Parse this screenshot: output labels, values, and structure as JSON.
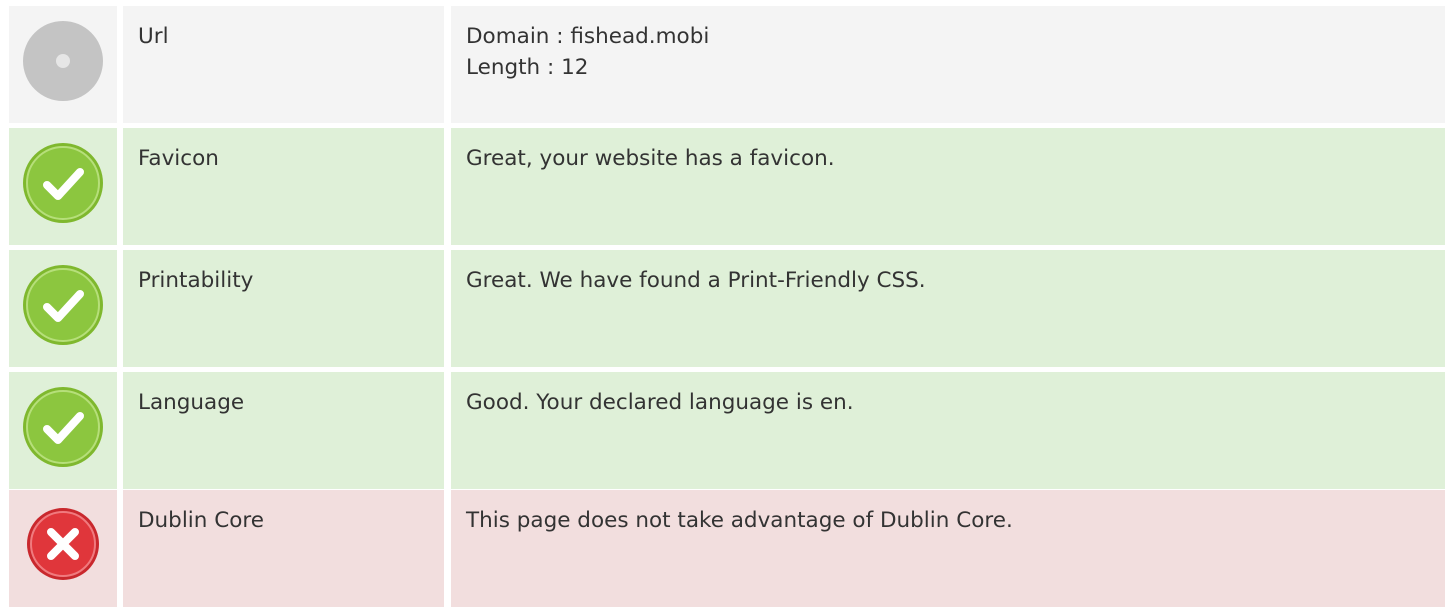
{
  "colors": {
    "neutral_bg": "#f4f4f4",
    "pass_bg": "#dff0d8",
    "fail_bg": "#f2dede",
    "pass_icon": "#8cc63f",
    "fail_icon": "#e0363b",
    "neutral_icon": "#c4c4c4",
    "text": "#333333"
  },
  "rows": [
    {
      "status": "neutral",
      "icon": "neutral-dot-icon",
      "label": "Url",
      "lines": [
        "Domain : fishead.mobi",
        "Length : 12"
      ]
    },
    {
      "status": "pass",
      "icon": "check-circle-icon",
      "label": "Favicon",
      "lines": [
        "Great, your website has a favicon."
      ]
    },
    {
      "status": "pass",
      "icon": "check-circle-icon",
      "label": "Printability",
      "lines": [
        "Great. We have found a Print-Friendly CSS."
      ]
    },
    {
      "status": "pass",
      "icon": "check-circle-icon",
      "label": "Language",
      "lines": [
        "Good. Your declared language is en."
      ]
    },
    {
      "status": "fail",
      "icon": "x-circle-icon",
      "label": "Dublin Core",
      "lines": [
        "This page does not take advantage of Dublin Core."
      ]
    }
  ]
}
